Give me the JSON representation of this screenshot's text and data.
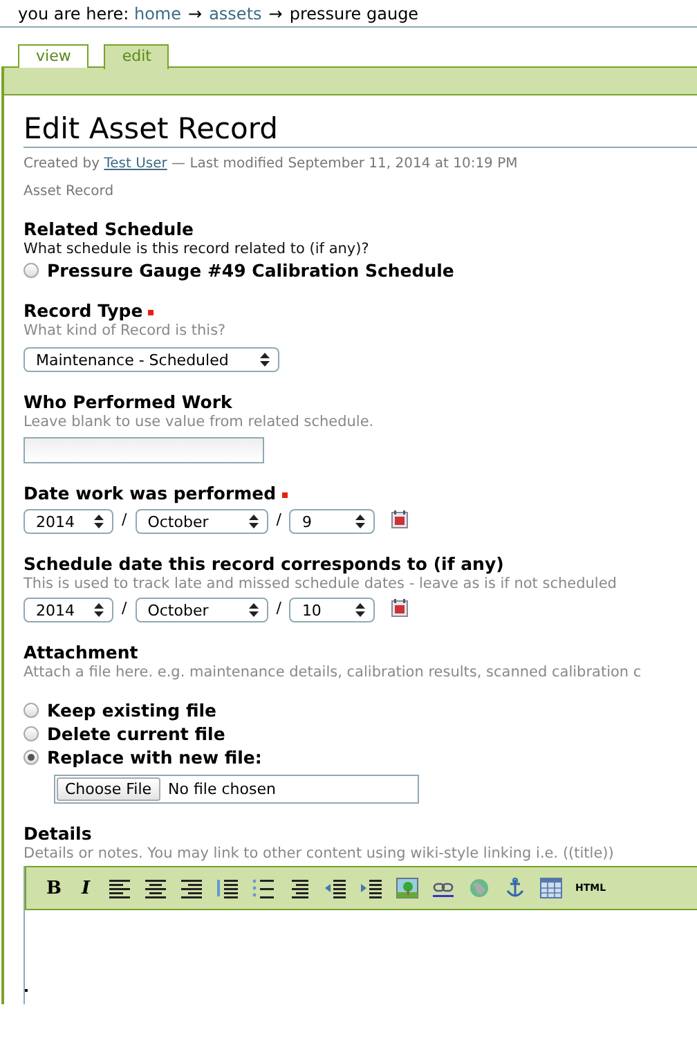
{
  "breadcrumb": {
    "prefix": "you are here:",
    "items": [
      {
        "label": "home",
        "link": true
      },
      {
        "label": "assets",
        "link": true
      },
      {
        "label": "pressure gauge",
        "link": false
      }
    ],
    "separator": "→"
  },
  "tabs": [
    {
      "label": "view",
      "selected": false
    },
    {
      "label": "edit",
      "selected": true
    }
  ],
  "title": "Edit Asset Record",
  "meta": {
    "created_by": "Created by",
    "author": "Test User",
    "modified": "— Last modified September 11, 2014 at 10:19 PM"
  },
  "record_type_label": "Asset Record",
  "fields": [
    {
      "kind": "radio",
      "label": "Related Schedule",
      "required": false,
      "description": "What schedule is this record related to (if any)?",
      "desc_dark": true,
      "options": [
        {
          "label": "Pressure Gauge #49 Calibration Schedule",
          "selected": false
        }
      ]
    },
    {
      "kind": "select",
      "label": "Record Type",
      "required": true,
      "description": "What kind of Record is this?",
      "value": "Maintenance - Scheduled"
    },
    {
      "kind": "text",
      "label": "Who Performed Work",
      "required": false,
      "description": "Leave blank to use value from related schedule."
    },
    {
      "kind": "date",
      "label": "Date work was performed",
      "required": true,
      "year": "2014",
      "month": "October",
      "day": "9",
      "separator": "/"
    },
    {
      "kind": "date",
      "label": "Schedule date this record corresponds to (if any)",
      "required": false,
      "description": "This is used to track late and missed schedule dates - leave as is if not scheduled",
      "year": "2014",
      "month": "October",
      "day": "10",
      "separator": "/"
    },
    {
      "kind": "file",
      "label": "Attachment",
      "required": false,
      "description": "Attach a file here. e.g. maintenance details, calibration results, scanned calibration c",
      "options": [
        {
          "label": "Keep existing file",
          "selected": false
        },
        {
          "label": "Delete current file",
          "selected": false
        },
        {
          "label": "Replace with new file:",
          "selected": true
        }
      ],
      "button": "Choose File",
      "status": "No file chosen"
    },
    {
      "kind": "editor",
      "label": "Details",
      "required": false,
      "description": "Details or notes. You may link to other content using wiki-style linking i.e. ((title))",
      "bold": "B",
      "italic": "I",
      "html": "HTML"
    }
  ]
}
